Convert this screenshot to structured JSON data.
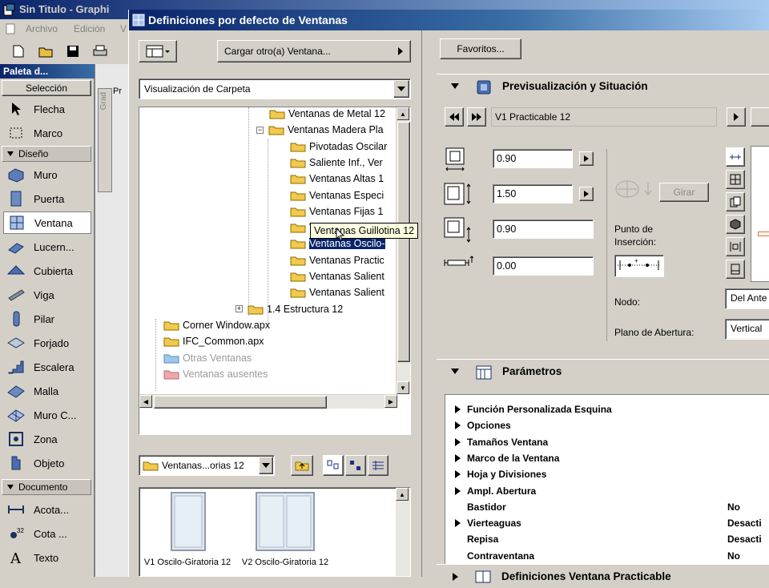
{
  "app": {
    "title": "Sin Titulo - Graphi",
    "menu": [
      "Archivo",
      "Edición",
      "V"
    ],
    "palette_title": "Paleta d...",
    "palette": {
      "seleccion_label": "Selección",
      "seleccion_items": [
        "Flecha",
        "Marco"
      ],
      "diseno_label": "Diseño",
      "diseno_items": [
        "Muro",
        "Puerta",
        "Ventana",
        "Lucern...",
        "Cubierta",
        "Viga",
        "Pilar",
        "Forjado",
        "Escalera",
        "Malla",
        "Muro C...",
        "Zona",
        "Objeto"
      ],
      "documento_label": "Documento",
      "documento_items": [
        "Acota...",
        "Cota ...",
        "Texto"
      ]
    },
    "canvas_label": "Pr",
    "vertical_tab": "Grad"
  },
  "dialog": {
    "title": "Definiciones por defecto de Ventanas",
    "load_button": "Cargar otro(a) Ventana...",
    "view_select": "Visualización de Carpeta",
    "favorites_button": "Favoritos...",
    "tree": [
      {
        "label": "Ventanas de Metal 12",
        "kind": "folder"
      },
      {
        "label": "Ventanas Madera Pla",
        "kind": "folder-open"
      },
      {
        "label": "Pivotadas Oscilar",
        "kind": "folder"
      },
      {
        "label": "Saliente Inf., Ver",
        "kind": "folder"
      },
      {
        "label": "Ventanas Altas 1",
        "kind": "folder"
      },
      {
        "label": "Ventanas Especi",
        "kind": "folder"
      },
      {
        "label": "Ventanas Fijas 1",
        "kind": "folder"
      },
      {
        "label": "Ventanas Guillotina 12",
        "kind": "folder"
      },
      {
        "label": "Ventanas Oscilo-",
        "kind": "folder"
      },
      {
        "label": "Ventanas Practic",
        "kind": "folder"
      },
      {
        "label": "Ventanas Salient",
        "kind": "folder"
      },
      {
        "label": "Ventanas Salient",
        "kind": "folder"
      },
      {
        "label": "1.4 Estructura 12",
        "kind": "folder"
      },
      {
        "label": "Corner Window.apx",
        "kind": "folder"
      },
      {
        "label": "IFC_Common.apx",
        "kind": "folder"
      },
      {
        "label": "Otras Ventanas",
        "kind": "special-blue"
      },
      {
        "label": "Ventanas ausentes",
        "kind": "special-red"
      }
    ],
    "tooltip": "Ventanas Guillotina 12",
    "folder_select": "Ventanas...orias 12",
    "thumbnails": [
      {
        "label": "V1 Oscilo-Giratoria 12"
      },
      {
        "label": "V2 Oscilo-Giratoria 12"
      }
    ],
    "preview": {
      "section_title": "Previsualización y Situación",
      "current_name": "V1 Practicable 12",
      "fields": [
        "0.90",
        "1.50",
        "0.90",
        "0.00"
      ],
      "rotate_button": "Girar",
      "insertion_point_label": "Punto de Inserción:",
      "node_label": "Nodo:",
      "node_value": "Del Ante",
      "opening_plane_label": "Plano de Abertura:",
      "opening_plane_value": "Vertical"
    },
    "params": {
      "section_title": "Parámetros",
      "rows": [
        {
          "label": "Función Personalizada Esquina",
          "expandable": true,
          "value": ""
        },
        {
          "label": "Opciones",
          "expandable": true,
          "value": ""
        },
        {
          "label": "Tamaños Ventana",
          "expandable": true,
          "value": ""
        },
        {
          "label": "Marco de la Ventana",
          "expandable": true,
          "value": ""
        },
        {
          "label": "Hoja y Divisiones",
          "expandable": true,
          "value": ""
        },
        {
          "label": "Ampl. Abertura",
          "expandable": true,
          "value": ""
        },
        {
          "label": "Bastidor",
          "expandable": false,
          "value": "No"
        },
        {
          "label": "Vierteaguas",
          "expandable": true,
          "value": "Desacti"
        },
        {
          "label": "Repisa",
          "expandable": false,
          "value": "Desacti"
        },
        {
          "label": "Contraventana",
          "expandable": false,
          "value": "No"
        }
      ]
    },
    "bottom_section_title": "Definiciones Ventana Practicable"
  }
}
